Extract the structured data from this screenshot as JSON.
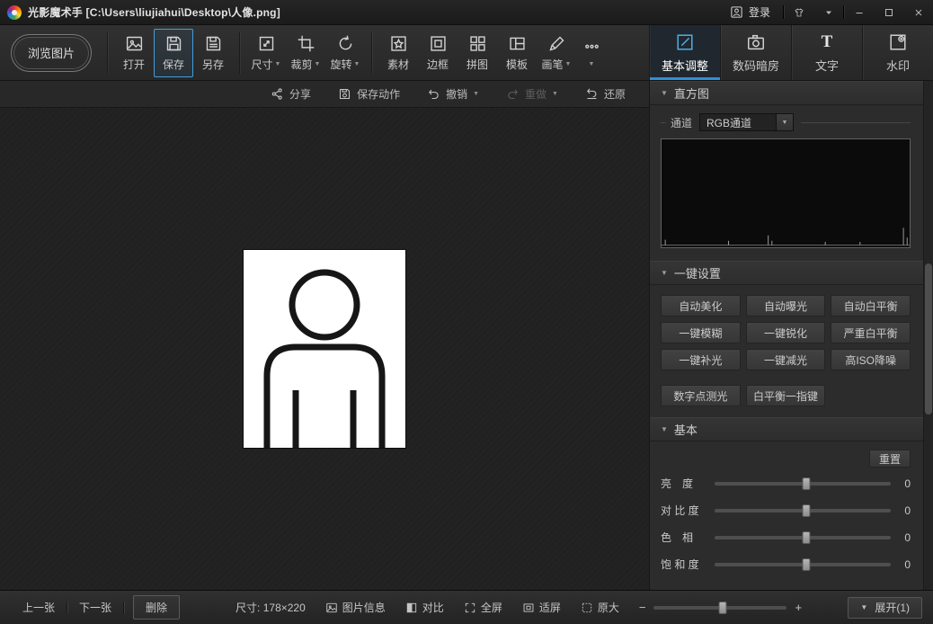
{
  "colors": {
    "accent": "#2f8fd4",
    "save_highlight": "#3f9fe0",
    "canvas_bg": "#212121"
  },
  "icons": {
    "dropdown": "▼",
    "section_arrow": "▼",
    "minus": "−",
    "plus": "+"
  },
  "title_bar": {
    "app_title": "光影魔术手 [C:\\Users\\liujiahui\\Desktop\\人像.png]",
    "login_label": "登录"
  },
  "toolbar": {
    "browse_label": "浏览图片",
    "items": [
      {
        "label": "打开"
      },
      {
        "label": "保存"
      },
      {
        "label": "另存"
      },
      {
        "label": "尺寸"
      },
      {
        "label": "裁剪"
      },
      {
        "label": "旋转"
      },
      {
        "label": "素材"
      },
      {
        "label": "边框"
      },
      {
        "label": "拼图"
      },
      {
        "label": "模板"
      },
      {
        "label": "画笔"
      }
    ],
    "tabs": [
      {
        "label": "基本调整"
      },
      {
        "label": "数码暗房"
      },
      {
        "label": "文字"
      },
      {
        "label": "水印"
      }
    ]
  },
  "action_bar": {
    "share": "分享",
    "save_action": "保存动作",
    "undo": "撤销",
    "redo": "重做",
    "restore": "还原"
  },
  "right_panel": {
    "histogram": {
      "title": "直方图",
      "channel_label": "通道",
      "channel_value": "RGB通道",
      "spikes": [
        {
          "x": 1.5,
          "h": 5
        },
        {
          "x": 27,
          "h": 4
        },
        {
          "x": 43,
          "h": 9
        },
        {
          "x": 44.5,
          "h": 4
        },
        {
          "x": 66,
          "h": 3
        },
        {
          "x": 80,
          "h": 3
        },
        {
          "x": 97.5,
          "h": 16
        },
        {
          "x": 99,
          "h": 7
        }
      ]
    },
    "one_key": {
      "title": "一键设置",
      "buttons": [
        "自动美化",
        "自动曝光",
        "自动白平衡",
        "一键模糊",
        "一键锐化",
        "严重白平衡",
        "一键补光",
        "一键减光",
        "高ISO降噪",
        "数字点测光",
        "白平衡一指键"
      ]
    },
    "basic": {
      "title": "基本",
      "reset": "重置",
      "sliders": [
        {
          "label": "亮　度",
          "value": "0"
        },
        {
          "label": "对 比 度",
          "value": "0"
        },
        {
          "label": "色　相",
          "value": "0"
        },
        {
          "label": "饱 和 度",
          "value": "0"
        }
      ]
    }
  },
  "status_bar": {
    "prev": "上一张",
    "next": "下一张",
    "delete": "删除",
    "size_info": "尺寸: 178×220",
    "image_info": "图片信息",
    "compare": "对比",
    "fullscreen": "全屏",
    "fit_screen": "适屏",
    "original": "原大",
    "expand": "展开(1)"
  }
}
